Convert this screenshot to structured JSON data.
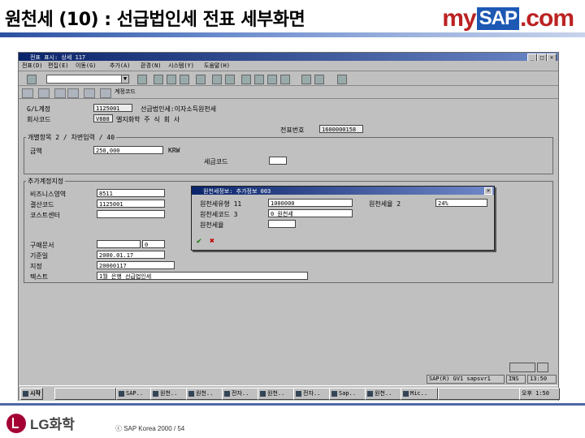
{
  "slide": {
    "title": "원천세 (10) : 선급법인세 전표 세부화면",
    "logo": {
      "my": "my",
      "sap": "SAP",
      "com": ".com"
    },
    "colors": {
      "title_rule": "#2a50a0",
      "sap_blue": "#1c58b4",
      "logo_red": "#b22222",
      "lg_red": "#a50034"
    }
  },
  "window": {
    "title": "전표 표시: 상세 117",
    "menu": [
      "전표(D)",
      "편집(E)",
      "이동(G)",
      "추가(A)",
      "환경(N)",
      "시스템(Y)",
      "도움말(H)"
    ],
    "document_info_button": "계정코드",
    "header": {
      "account_label": "G/L계정",
      "account_value": "1125001",
      "account_desc": "선급법인세:이자소득원천세",
      "company_label": "회사코드",
      "company_value": "V888",
      "company_desc": "엘지화학 주 식 회 사",
      "doc_number_label": "전표번호",
      "doc_number_value": "1600000158"
    },
    "item_group": {
      "title": "개별항목 2 / 차변입력 / 40",
      "amount_label": "금액",
      "amount_value": "250,000",
      "currency": "KRW",
      "tax_code_label": "세금코드"
    },
    "additional_group": {
      "title": "추가계정지정",
      "business_area_label": "비즈니스영역",
      "business_area_value": "8511",
      "profit_center_label": "결산코드",
      "profit_center_value": "1125001",
      "cost_center_label": "코스트센터",
      "purchase_doc_label": "구매문서",
      "purchase_doc_value": "0",
      "value_date_label": "기준일",
      "value_date_value": "2000.01.17",
      "assignment_label": "지정",
      "assignment_value": "20000117",
      "text_label": "텍스트",
      "text_value": "1월 은행 선급법인세"
    },
    "popup": {
      "title": "원천세정보: 추가정보 003",
      "wt_type_label": "원천세유형 11",
      "wt_type_value": "1000000",
      "wt_code_label": "원천세코드 3",
      "wt_code_value": "0 원천세",
      "wt_base_label": "원천세율",
      "rate_label": "원천세율 2",
      "rate_value": "24%",
      "ok": "✔",
      "cancel": "✖"
    },
    "status": {
      "system": "SAP(R) GV1",
      "client": "sapsvr1",
      "mode": "INS",
      "time": "13:50"
    },
    "taskbar": {
      "start": "시작",
      "items": [
        "SAP..",
        "원천..",
        "원천..",
        "전자..",
        "원천..",
        "전자..",
        "Sap..",
        "원천..",
        "Mic.."
      ],
      "clock": "오후 1:50"
    }
  },
  "footer": {
    "company": "LG화학",
    "copyright": "ⓒ SAP Korea 2000 / 54"
  }
}
